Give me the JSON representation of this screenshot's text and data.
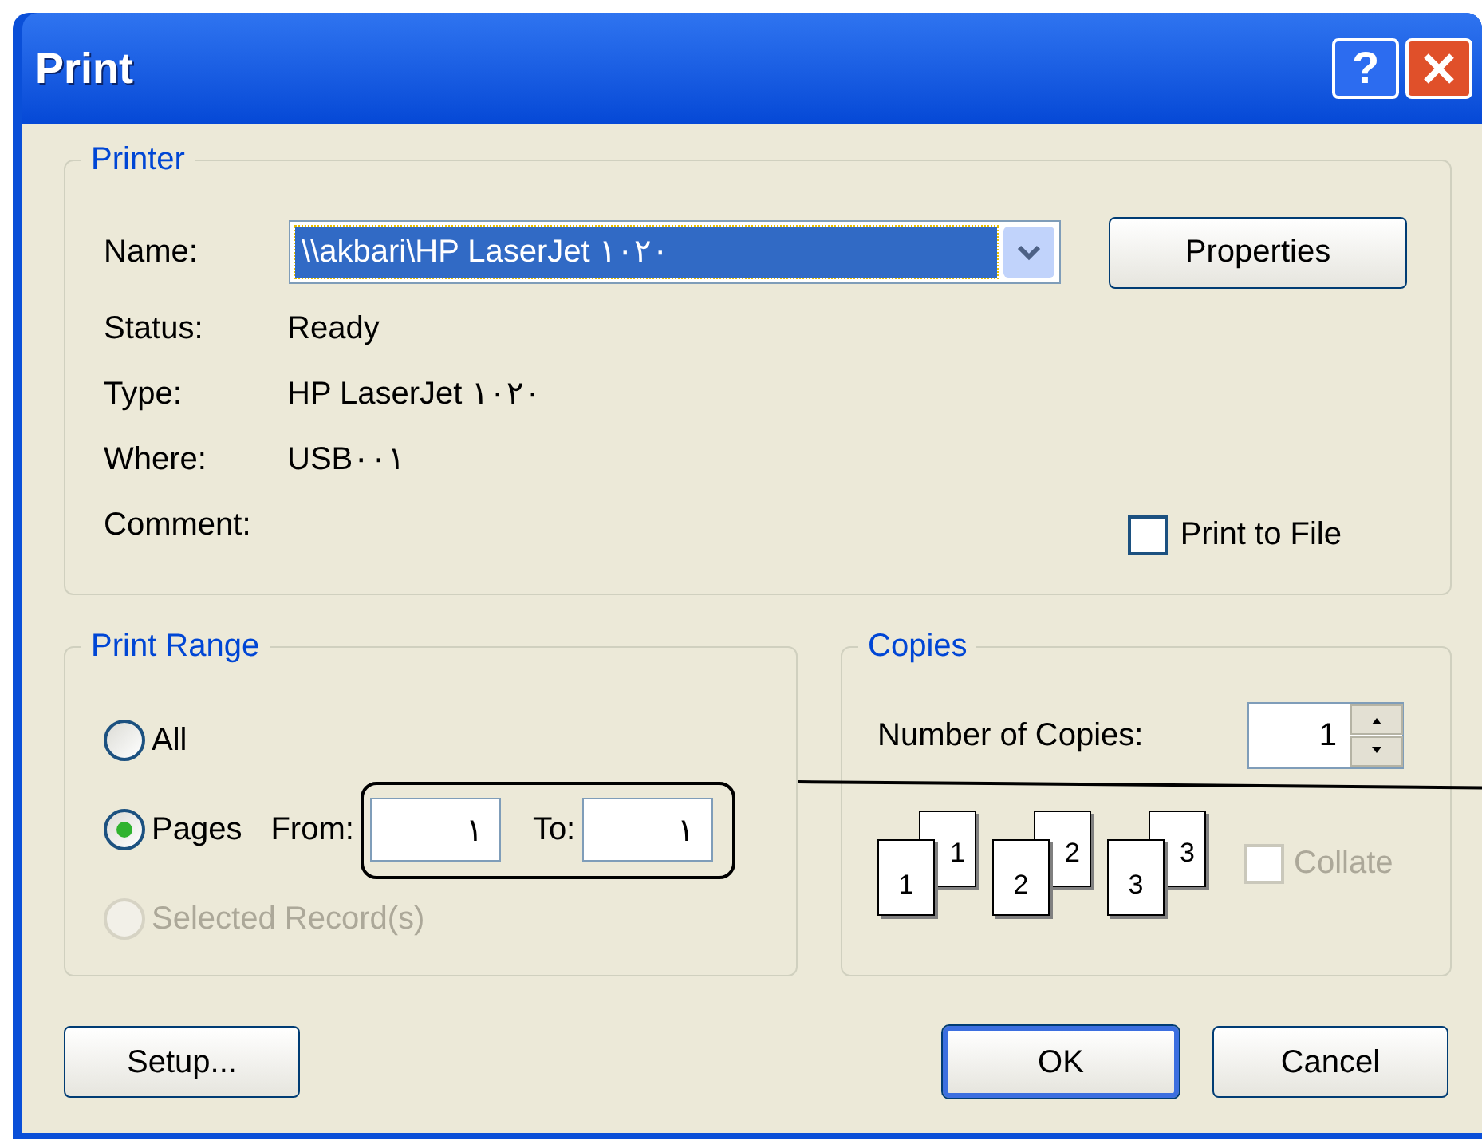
{
  "window": {
    "title": "Print"
  },
  "title_buttons": [
    {
      "kind": "help",
      "label": "?"
    },
    {
      "kind": "close"
    }
  ],
  "printer": {
    "legend": "Printer",
    "name_label": "Name:",
    "name_value": "\\\\akbari\\HP LaserJet ١٠٢٠",
    "name_focused": true,
    "properties_button": "Properties",
    "info": [
      {
        "label": "Status:",
        "value": "Ready"
      },
      {
        "label": "Type:",
        "value": "HP LaserJet ١٠٢٠"
      },
      {
        "label": "Where:",
        "value": "USB٠٠١"
      },
      {
        "label": "Comment:"
      }
    ],
    "print_to_file": {
      "label": "Print to File",
      "checked": false
    }
  },
  "print_range": {
    "legend": "Print Range",
    "options": [
      {
        "kind": "all",
        "label": "All",
        "selected": false,
        "disabled": false
      },
      {
        "kind": "pages",
        "label": "Pages",
        "selected": true,
        "disabled": false
      },
      {
        "kind": "selection",
        "label": "Selected Record(s)",
        "selected": false,
        "disabled": true
      }
    ],
    "from_label": "From:",
    "from_value": "١",
    "to_label": "To:",
    "to_value": "١"
  },
  "copies": {
    "legend": "Copies",
    "number_label": "Number of Copies:",
    "number_value": "1",
    "collate_pages": [
      {
        "front": "1",
        "back": "1"
      },
      {
        "front": "2",
        "back": "2"
      },
      {
        "front": "3",
        "back": "3"
      }
    ],
    "collate": {
      "label": "Collate",
      "checked": false,
      "disabled": true
    }
  },
  "buttons": [
    {
      "kind": "setup",
      "label": "Setup...",
      "default": false
    },
    {
      "kind": "ok",
      "label": "OK",
      "default": true
    },
    {
      "kind": "cancel",
      "label": "Cancel",
      "default": false
    }
  ]
}
